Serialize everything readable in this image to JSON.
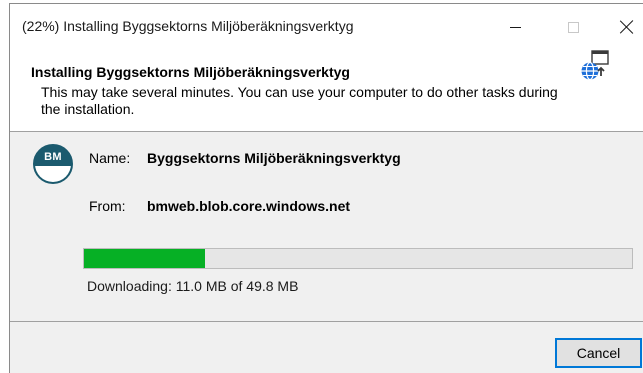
{
  "window": {
    "title": "(22%) Installing Byggsektorns Miljöberäkningsverktyg"
  },
  "header": {
    "title": "Installing Byggsektorns Miljöberäkningsverktyg",
    "description": "This may take several minutes. You can use your computer to do other tasks during the installation."
  },
  "app": {
    "avatar_initials": "BM",
    "name_label": "Name:",
    "name_value": "Byggsektorns Miljöberäkningsverktyg",
    "from_label": "From:",
    "from_value": "bmweb.blob.core.windows.net"
  },
  "progress": {
    "fraction": 0.22,
    "status": "Downloading: 11.0 MB of 49.8 MB"
  },
  "buttons": {
    "cancel": "Cancel"
  },
  "icons": {
    "title_bar": [
      "minimize-icon",
      "maximize-icon",
      "close-icon"
    ],
    "installer": "installer-globe-icon"
  },
  "colors": {
    "progress_fill": "#06b025",
    "avatar": "#1b5a6e",
    "button_focus": "#0078d7"
  }
}
